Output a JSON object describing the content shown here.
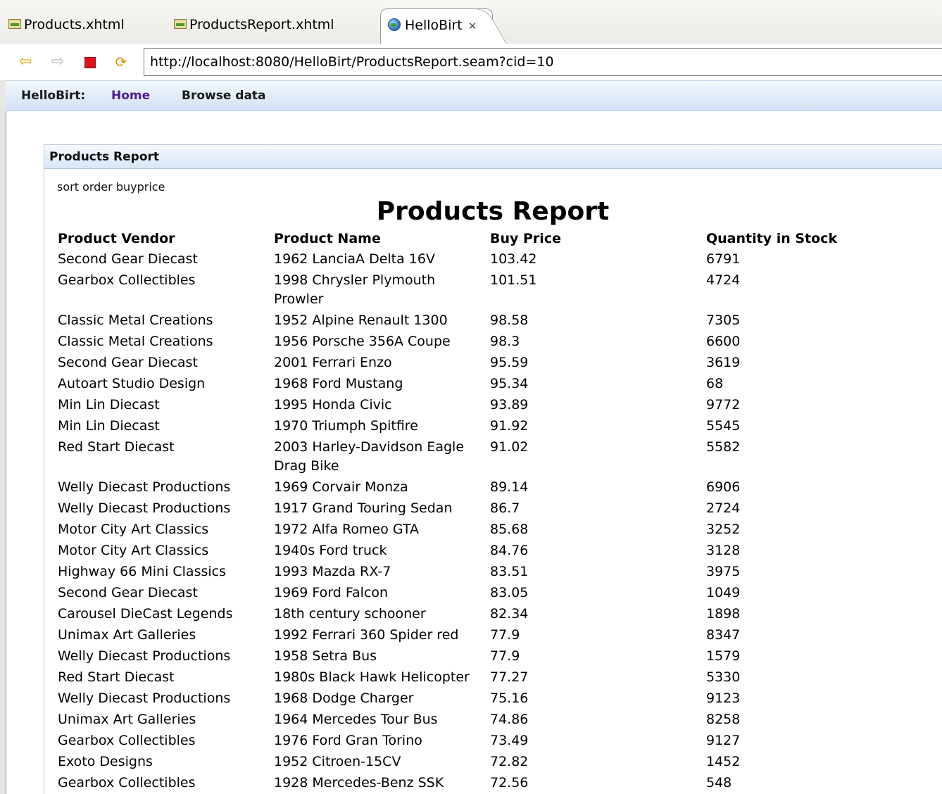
{
  "editor_tabs": [
    {
      "label": "Products.xhtml",
      "icon": "xhtml-file-icon"
    },
    {
      "label": "ProductsReport.xhtml",
      "icon": "xhtml-file-icon"
    },
    {
      "label": "HelloBirt",
      "icon": "globe-icon",
      "active": true
    }
  ],
  "browser": {
    "url": "http://localhost:8080/HelloBirt/ProductsReport.seam?cid=10",
    "buttons": [
      "back-icon",
      "forward-icon",
      "stop-icon",
      "refresh-icon"
    ]
  },
  "nav": {
    "brand": "HelloBirt:",
    "home": "Home",
    "browse": "Browse data"
  },
  "panel": {
    "header": "Products Report",
    "sort_label": "sort order buyprice",
    "report_title": "Products Report"
  },
  "table": {
    "columns": [
      "Product Vendor",
      "Product Name",
      "Buy Price",
      "Quantity in Stock"
    ],
    "rows": [
      [
        "Second Gear Diecast",
        "1962 LanciaA Delta 16V",
        "103.42",
        "6791"
      ],
      [
        "Gearbox Collectibles",
        "1998 Chrysler Plymouth Prowler",
        "101.51",
        "4724"
      ],
      [
        "Classic Metal Creations",
        "1952 Alpine Renault 1300",
        "98.58",
        "7305"
      ],
      [
        "Classic Metal Creations",
        "1956 Porsche 356A Coupe",
        "98.3",
        "6600"
      ],
      [
        "Second Gear Diecast",
        "2001 Ferrari Enzo",
        "95.59",
        "3619"
      ],
      [
        "Autoart Studio Design",
        "1968 Ford Mustang",
        "95.34",
        "68"
      ],
      [
        "Min Lin Diecast",
        "1995 Honda Civic",
        "93.89",
        "9772"
      ],
      [
        "Min Lin Diecast",
        "1970 Triumph Spitfire",
        "91.92",
        "5545"
      ],
      [
        "Red Start Diecast",
        "2003 Harley-Davidson Eagle Drag Bike",
        "91.02",
        "5582"
      ],
      [
        "Welly Diecast Productions",
        "1969 Corvair Monza",
        "89.14",
        "6906"
      ],
      [
        "Welly Diecast Productions",
        "1917 Grand Touring Sedan",
        "86.7",
        "2724"
      ],
      [
        "Motor City Art Classics",
        "1972 Alfa Romeo GTA",
        "85.68",
        "3252"
      ],
      [
        "Motor City Art Classics",
        "1940s Ford truck",
        "84.76",
        "3128"
      ],
      [
        "Highway 66 Mini Classics",
        "1993 Mazda RX-7",
        "83.51",
        "3975"
      ],
      [
        "Second Gear Diecast",
        "1969 Ford Falcon",
        "83.05",
        "1049"
      ],
      [
        "Carousel DieCast Legends",
        "18th century schooner",
        "82.34",
        "1898"
      ],
      [
        "Unimax Art Galleries",
        "1992 Ferrari 360 Spider red",
        "77.9",
        "8347"
      ],
      [
        "Welly Diecast Productions",
        "1958 Setra Bus",
        "77.9",
        "1579"
      ],
      [
        "Red Start Diecast",
        "1980s Black Hawk Helicopter",
        "77.27",
        "5330"
      ],
      [
        "Welly Diecast Productions",
        "1968 Dodge Charger",
        "75.16",
        "9123"
      ],
      [
        "Unimax Art Galleries",
        "1964 Mercedes Tour Bus",
        "74.86",
        "8258"
      ],
      [
        "Gearbox Collectibles",
        "1976 Ford Gran Torino",
        "73.49",
        "9127"
      ],
      [
        "Exoto Designs",
        "1952 Citroen-15CV",
        "72.82",
        "1452"
      ],
      [
        "Gearbox Collectibles",
        "1928 Mercedes-Benz SSK",
        "72.56",
        "548"
      ]
    ]
  }
}
